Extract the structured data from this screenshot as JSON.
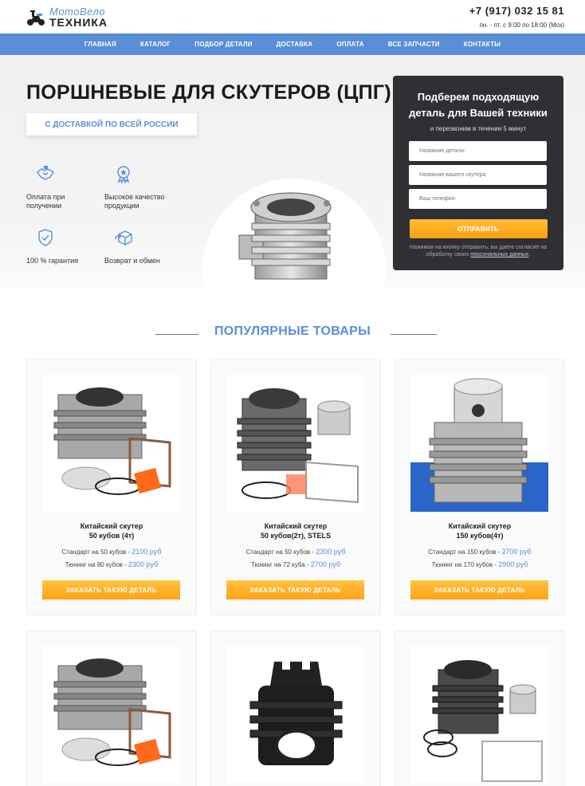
{
  "header": {
    "logo_line1": "МотоВело",
    "logo_line2": "ТЕХНИКА",
    "phone": "+7 (917) 032 15 81",
    "hours": "пн. - пт. с 9:00 по 18:00 (Мск)"
  },
  "nav": {
    "items": [
      "ГЛАВНАЯ",
      "КАТАЛОГ",
      "ПОДБОР ДЕТАЛИ",
      "ДОСТАВКА",
      "ОПЛАТА",
      "ВСЕ ЗАПЧАСТИ",
      "КОНТАКТЫ"
    ]
  },
  "hero": {
    "title": "ПОРШНЕВЫЕ ДЛЯ СКУТЕРОВ (ЦПГ)",
    "badge": "С ДОСТАВКОЙ ПО ВСЕЙ РОССИИ",
    "features": [
      {
        "label": "Оплата при получении",
        "icon": "handshake-icon"
      },
      {
        "label": "Высокое качество продукции",
        "icon": "quality-badge-icon"
      },
      {
        "label": "100 % гарантия",
        "icon": "shield-check-icon"
      },
      {
        "label": "Возврат и обмен",
        "icon": "return-box-icon"
      }
    ]
  },
  "form": {
    "title": "Подберем подходящую деталь для Вашей техники",
    "subtitle": "и перезвоним в течении 5 минут",
    "placeholder_part": "Название детали:",
    "placeholder_scooter": "Название вашего скутера:",
    "placeholder_phone": "Ваш телефон:",
    "submit": "ОТПРАВИТЬ",
    "note_prefix": "Нажимая на кнопку отправить, вы даете согласие на обработку своих",
    "note_link": "персональных данных",
    "note_suffix": "."
  },
  "section": {
    "title": "ПОПУЛЯРНЫЕ ТОВАРЫ"
  },
  "products": [
    {
      "name_line1": "Китайский скутер",
      "name_line2": "50 кубов (4т)",
      "standard_label": "Стандарт на 50 кубов -",
      "standard_price": "2100 руб",
      "tuning_label": "Тюнинг на 80 кубов -",
      "tuning_price": "2300 руб",
      "button": "ЗАКАЗАТЬ ТАКУЮ ДЕТАЛЬ"
    },
    {
      "name_line1": "Китайский скутер",
      "name_line2": "50 кубов(2т), STELS",
      "standard_label": "Стандарт на 50 кубов -",
      "standard_price": "2300 руб",
      "tuning_label": "Тюнинг на 72 куба -",
      "tuning_price": "2700 руб",
      "button": "ЗАКАЗАТЬ ТАКУЮ ДЕТАЛЬ"
    },
    {
      "name_line1": "Китайский скутер",
      "name_line2": "150 кубов(4т)",
      "standard_label": "Стандарт на 150 кубов -",
      "standard_price": "2700 руб",
      "tuning_label": "Тюнинг на 170 кубов -",
      "tuning_price": "2900 руб",
      "button": "ЗАКАЗАТЬ ТАКУЮ ДЕТАЛЬ"
    }
  ]
}
